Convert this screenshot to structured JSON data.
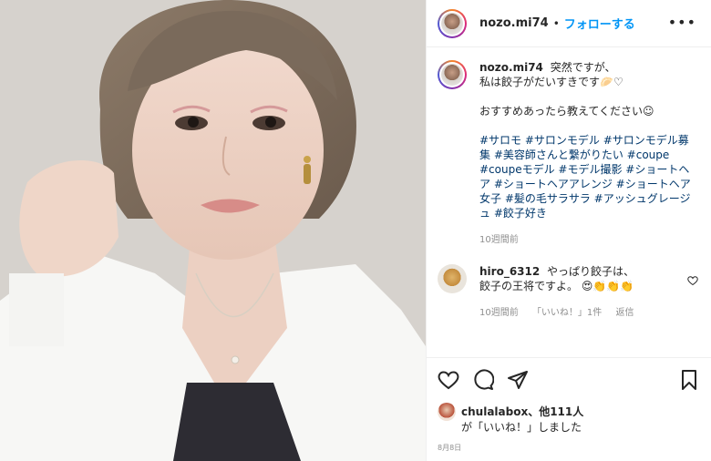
{
  "header": {
    "username": "nozo.mi74",
    "separator": "•",
    "follow_label": "フォローする",
    "more_label": "•••"
  },
  "caption": {
    "username": "nozo.mi74",
    "line1": "突然ですが、",
    "line2": "私は餃子がだいすきです",
    "line2_emoji": "🥟♡",
    "line3": "おすすめあったら教えてください☺",
    "hashtags": "#サロモ #サロンモデル #サロンモデル募集 #美容師さんと繋がりたい #coupe #coupeモデル #モデル撮影 #ショートヘア #ショートヘアアレンジ #ショートヘア女子 #髪の毛サラサラ #アッシュグレージュ #餃子好き",
    "time": "10週間前"
  },
  "reply": {
    "username": "hiro_6312",
    "text_line1": "やっぱり餃子は、",
    "text_line2": "餃子の王将ですよ。",
    "emoji": "😍👏👏👏",
    "time": "10週間前",
    "likes": "「いいね！」1件",
    "reply_label": "返信"
  },
  "likes": {
    "first_user": "chulalabox",
    "others": "、他111人",
    "suffix": "が「いいね！」しました"
  },
  "date": "8月8日",
  "colors": {
    "link": "#0095f6",
    "hashtag": "#00376b",
    "muted": "#8e8e8e"
  }
}
